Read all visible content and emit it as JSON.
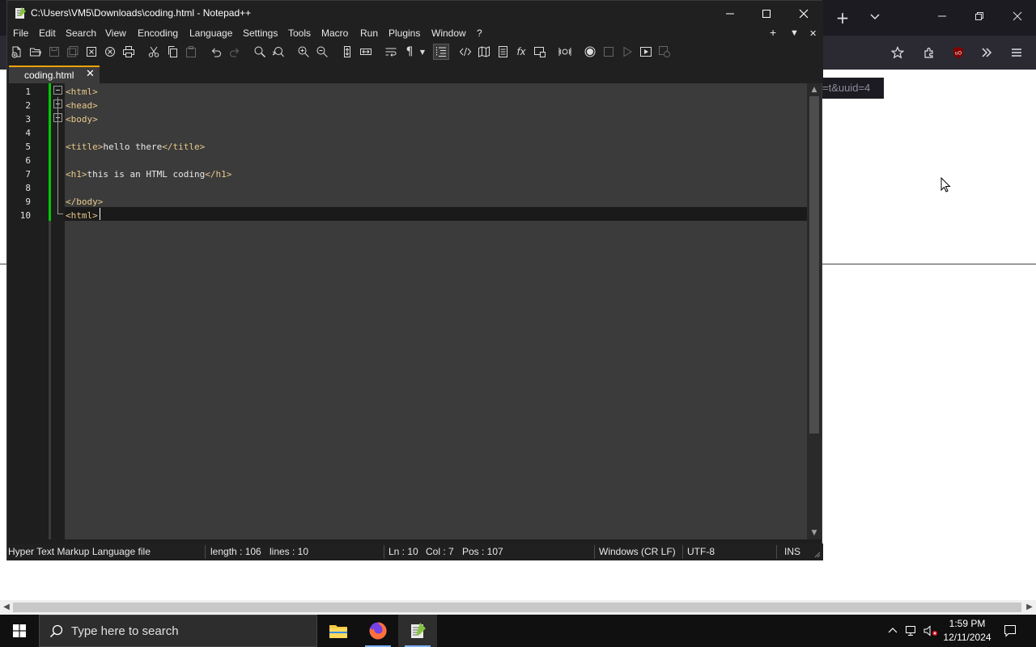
{
  "browser": {
    "url_fragment": "=t&uuid=4"
  },
  "notepad": {
    "title": "C:\\Users\\VM5\\Downloads\\coding.html - Notepad++",
    "menu": [
      "File",
      "Edit",
      "Search",
      "View",
      "Encoding",
      "Language",
      "Settings",
      "Tools",
      "Macro",
      "Run",
      "Plugins",
      "Window",
      "?"
    ],
    "menu_right": [
      "+",
      "▼",
      "✕"
    ],
    "tab": {
      "label": "coding.html",
      "close": "✕"
    },
    "lines": [
      {
        "num": "1",
        "parts": [
          [
            "tag",
            "<html>"
          ]
        ]
      },
      {
        "num": "2",
        "parts": [
          [
            "tag",
            "<head>"
          ]
        ]
      },
      {
        "num": "3",
        "parts": [
          [
            "tag",
            "<body>"
          ]
        ]
      },
      {
        "num": "4",
        "parts": []
      },
      {
        "num": "5",
        "parts": [
          [
            "tag",
            "<title>"
          ],
          [
            "txt",
            "hello there"
          ],
          [
            "tag",
            "</title>"
          ]
        ]
      },
      {
        "num": "6",
        "parts": []
      },
      {
        "num": "7",
        "parts": [
          [
            "tag",
            "<h1>"
          ],
          [
            "txt",
            "this is an HTML coding"
          ],
          [
            "tag",
            "</h1>"
          ]
        ]
      },
      {
        "num": "8",
        "parts": []
      },
      {
        "num": "9",
        "parts": [
          [
            "tag",
            "</body>"
          ]
        ]
      },
      {
        "num": "10",
        "parts": [
          [
            "tag",
            "<html>"
          ]
        ]
      }
    ],
    "status": {
      "filetype": "Hyper Text Markup Language file",
      "length": "length : 106",
      "lines": "lines : 10",
      "ln": "Ln : 10",
      "col": "Col : 7",
      "pos": "Pos : 107",
      "eol": "Windows (CR LF)",
      "encoding": "UTF-8",
      "mode": "INS"
    }
  },
  "taskbar": {
    "search_placeholder": "Type here to search",
    "time": "1:59 PM",
    "date": "12/11/2024"
  },
  "colors": {
    "accent_tab": "#f5a300",
    "change_bar": "#00c800",
    "tag_color": "#e8c98a"
  }
}
